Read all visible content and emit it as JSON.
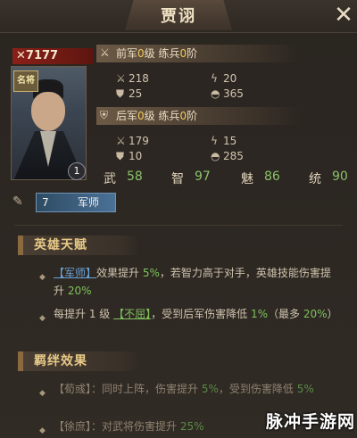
{
  "header": {
    "title": "贾诩",
    "close_icon": "close-icon"
  },
  "hero": {
    "power": "✕7177",
    "seal_text": "名将",
    "star_level": "1"
  },
  "troops": [
    {
      "title_prefix": "前军",
      "level": "0",
      "level_unit": "级 练兵",
      "train": "0",
      "train_unit": "阶",
      "attack": "218",
      "speed": "20",
      "defense": "25",
      "hp": "365"
    },
    {
      "title_prefix": "后军",
      "level": "0",
      "level_unit": "级 练兵",
      "train": "0",
      "train_unit": "阶",
      "attack": "179",
      "speed": "15",
      "defense": "10",
      "hp": "285"
    }
  ],
  "attributes": [
    {
      "label": "武",
      "value": "58"
    },
    {
      "label": "智",
      "value": "97"
    },
    {
      "label": "魅",
      "value": "86"
    },
    {
      "label": "统",
      "value": "90"
    }
  ],
  "rank": {
    "number": "7",
    "title": "军师"
  },
  "talent": {
    "header": "英雄天赋",
    "line1": {
      "tag": "【军师】",
      "t1": "效果提升 ",
      "v1": "5%",
      "t2": "，若智力高于对手，英雄技能伤害提升 ",
      "v2": "20%"
    },
    "line2": {
      "t1": "每提升 1 级 ",
      "tag": "【不屈】",
      "t2": "，受到后军伤害降低 ",
      "v1": "1%",
      "t3": "（最多 ",
      "v2": "20%",
      "t4": "）"
    }
  },
  "bond": {
    "header": "羁绊效果",
    "line1": {
      "t1": "【荀彧】：同时上阵，伤害提升 ",
      "v1": "5%",
      "t2": "，受到伤害降低 ",
      "v2": "5%"
    },
    "line2": {
      "t1": "【徐庶】：对武将伤害提升 ",
      "v1": "25%"
    }
  },
  "watermark": "脉冲手游网",
  "colors": {
    "highlight_green": "#7fc25c",
    "tag_blue": "#6aa3d8",
    "section_gold": "#e8c987",
    "power_red": "#8a2018"
  }
}
